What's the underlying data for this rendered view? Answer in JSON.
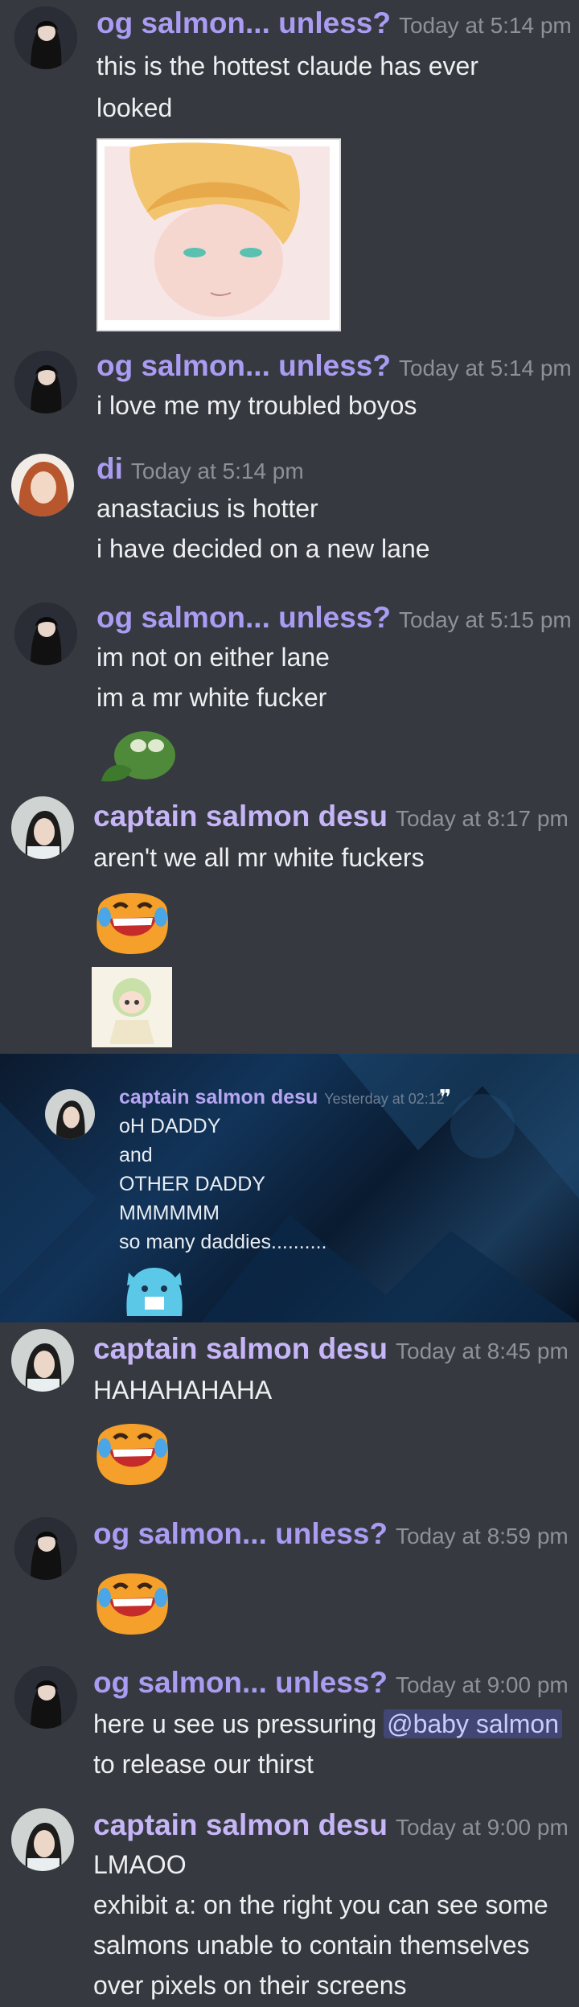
{
  "messages": [
    {
      "user": "og salmon... unless?",
      "time": "Today at 5:14 pm",
      "lines": [
        "this is the hottest claude has ever",
        "looked"
      ]
    },
    {
      "user": "og salmon... unless?",
      "time": "Today at 5:14 pm",
      "lines": [
        "i love me my troubled boyos"
      ]
    },
    {
      "user": "di",
      "time": "Today at 5:14 pm",
      "lines": [
        "anastacius is hotter",
        "i have decided on a new lane"
      ]
    },
    {
      "user": "og salmon... unless?",
      "time": "Today at 5:15 pm",
      "lines": [
        "im not on either lane",
        "im a mr white fucker"
      ]
    },
    {
      "user": "captain salmon desu",
      "time": "Today at 8:17 pm",
      "lines": [
        "aren't we all mr white fuckers"
      ]
    },
    {
      "user": "captain salmon desu",
      "time": "Today at 8:45 pm",
      "lines": [
        "HAHAHAHAHA"
      ]
    },
    {
      "user": "og salmon... unless?",
      "time": "Today at 8:59 pm",
      "lines": []
    },
    {
      "user": "og salmon... unless?",
      "time": "Today at 9:00 pm",
      "line1_prefix": "here u see us pressuring ",
      "mention": "@baby salmon",
      "line2": "to release our thirst"
    },
    {
      "user": "captain salmon desu",
      "time": "Today at 9:00 pm",
      "lines": [
        "LMAOO",
        "exhibit a: on the right you can see some",
        "salmons unable to contain themselves",
        "over pixels on their screens"
      ]
    }
  ],
  "quote": {
    "user": "captain salmon desu",
    "time": "Yesterday at 02:12",
    "quote_icon": "quote-icon",
    "lines": [
      "oH DADDY",
      "and",
      "OTHER DADDY",
      "MMMMMM",
      "so many daddies.........."
    ]
  },
  "icons": {
    "laughing_emoji": "laughing-crying-emoji",
    "frog_emoji": "frog-hand-emoji",
    "sticker": "chibi-character-sticker",
    "cat_emoji": "blue-cat-emoji"
  },
  "colors": {
    "background": "#36393f",
    "username": "#a99cf2",
    "mention_bg": "#414675",
    "timestamp": "#8e9297"
  }
}
